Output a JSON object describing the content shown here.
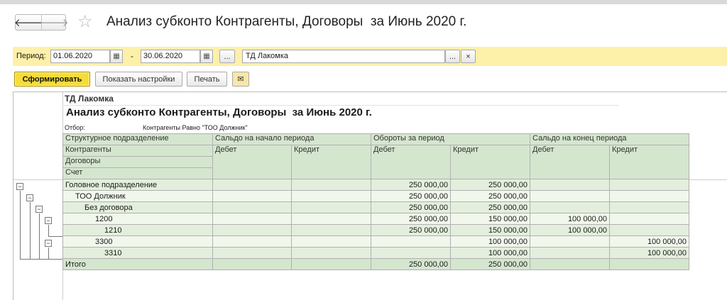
{
  "window": {
    "title": "Анализ субконто Контрагенты, Договоры  за Июнь 2020 г.",
    "nav_back": "🡐",
    "nav_forward": "🡒",
    "favorite_icon": "star-icon"
  },
  "period_bar": {
    "period_label": "Период:",
    "date_from": "01.06.2020",
    "date_to": "30.06.2020",
    "dash": "-",
    "select_period_label": "...",
    "counterparty": "ТД Лакомка",
    "choose_label": "...",
    "clear_label": "×"
  },
  "toolbar": {
    "generate_label": "Сформировать",
    "settings_label": "Показать настройки",
    "print_label": "Печать",
    "email_icon": "envelope-icon"
  },
  "report": {
    "organization": "ТД Лакомка",
    "title": "Анализ субконто Контрагенты, Договоры  за Июнь 2020 г.",
    "filter_label": "Отбор:",
    "filter_value": "Контрагенты Равно \"ТОО Должник\"",
    "headers": {
      "structure": "Структурное подразделение",
      "contractors": "Контрагенты",
      "contracts": "Договоры",
      "account": "Счет",
      "opening": "Сальдо на начало периода",
      "turnover": "Обороты за период",
      "closing": "Сальдо на конец периода",
      "debit": "Дебет",
      "credit": "Кредит"
    },
    "rows": [
      {
        "name": "Головное подразделение",
        "open_d": "",
        "open_c": "",
        "turn_d": "250 000,00",
        "turn_c": "250 000,00",
        "close_d": "",
        "close_c": ""
      },
      {
        "name": "ТОО Должник",
        "open_d": "",
        "open_c": "",
        "turn_d": "250 000,00",
        "turn_c": "250 000,00",
        "close_d": "",
        "close_c": ""
      },
      {
        "name": "Без договора",
        "open_d": "",
        "open_c": "",
        "turn_d": "250 000,00",
        "turn_c": "250 000,00",
        "close_d": "",
        "close_c": ""
      },
      {
        "name": "1200",
        "open_d": "",
        "open_c": "",
        "turn_d": "250 000,00",
        "turn_c": "150 000,00",
        "close_d": "100 000,00",
        "close_c": ""
      },
      {
        "name": "1210",
        "open_d": "",
        "open_c": "",
        "turn_d": "250 000,00",
        "turn_c": "150 000,00",
        "close_d": "100 000,00",
        "close_c": ""
      },
      {
        "name": "3300",
        "open_d": "",
        "open_c": "",
        "turn_d": "",
        "turn_c": "100 000,00",
        "close_d": "",
        "close_c": "100 000,00"
      },
      {
        "name": "3310",
        "open_d": "",
        "open_c": "",
        "turn_d": "",
        "turn_c": "100 000,00",
        "close_d": "",
        "close_c": "100 000,00"
      }
    ],
    "total": {
      "name": "Итого",
      "open_d": "",
      "open_c": "",
      "turn_d": "250 000,00",
      "turn_c": "250 000,00",
      "close_d": "",
      "close_c": ""
    },
    "tree_toggle": "−"
  }
}
